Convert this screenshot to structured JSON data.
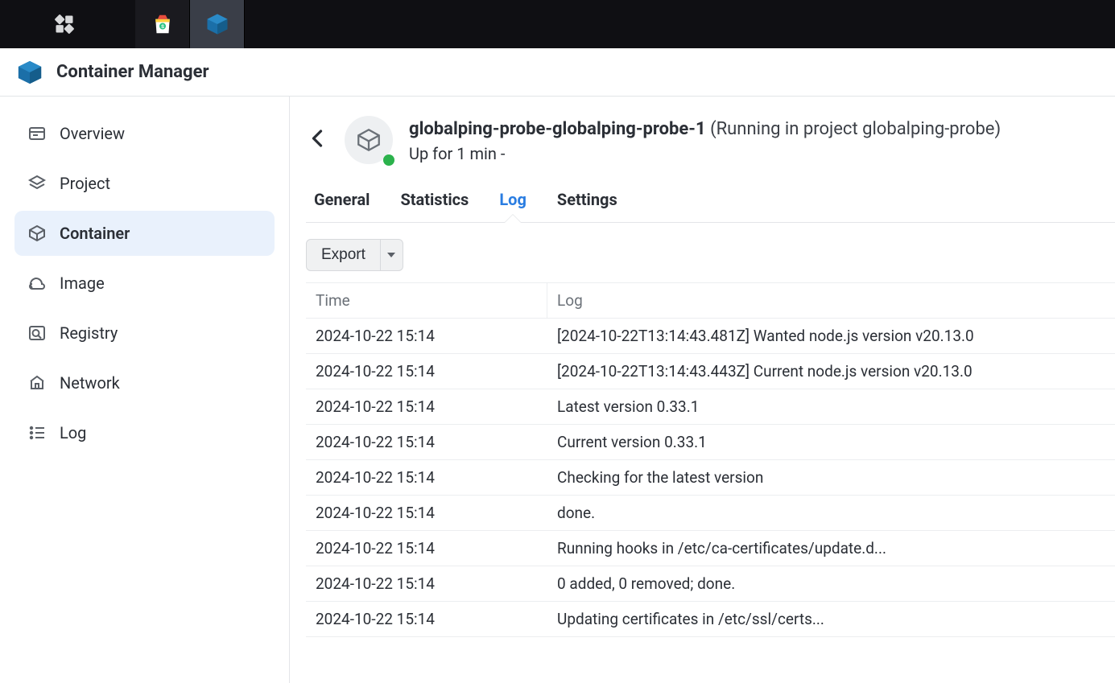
{
  "app": {
    "title": "Container Manager"
  },
  "sidebar": {
    "items": [
      {
        "label": "Overview",
        "icon": "overview",
        "selected": false
      },
      {
        "label": "Project",
        "icon": "project",
        "selected": false
      },
      {
        "label": "Container",
        "icon": "container",
        "selected": true
      },
      {
        "label": "Image",
        "icon": "image",
        "selected": false
      },
      {
        "label": "Registry",
        "icon": "registry",
        "selected": false
      },
      {
        "label": "Network",
        "icon": "network",
        "selected": false
      },
      {
        "label": "Log",
        "icon": "log",
        "selected": false
      }
    ]
  },
  "detail": {
    "name": "globalping-probe-globalping-probe-1",
    "info": "(Running in project globalping-probe)",
    "sub": "Up for 1 min -",
    "status": "running"
  },
  "tabs": [
    {
      "label": "General",
      "selected": false
    },
    {
      "label": "Statistics",
      "selected": false
    },
    {
      "label": "Log",
      "selected": true
    },
    {
      "label": "Settings",
      "selected": false
    }
  ],
  "toolbar": {
    "export_label": "Export"
  },
  "log": {
    "columns": {
      "time": "Time",
      "log": "Log"
    },
    "rows": [
      {
        "time": "2024-10-22 15:14",
        "msg": "[2024-10-22T13:14:43.481Z] Wanted node.js version v20.13.0"
      },
      {
        "time": "2024-10-22 15:14",
        "msg": "[2024-10-22T13:14:43.443Z] Current node.js version v20.13.0"
      },
      {
        "time": "2024-10-22 15:14",
        "msg": "Latest version 0.33.1"
      },
      {
        "time": "2024-10-22 15:14",
        "msg": "Current version 0.33.1"
      },
      {
        "time": "2024-10-22 15:14",
        "msg": "Checking for the latest version"
      },
      {
        "time": "2024-10-22 15:14",
        "msg": "done."
      },
      {
        "time": "2024-10-22 15:14",
        "msg": "Running hooks in /etc/ca-certificates/update.d..."
      },
      {
        "time": "2024-10-22 15:14",
        "msg": "0 added, 0 removed; done."
      },
      {
        "time": "2024-10-22 15:14",
        "msg": "Updating certificates in /etc/ssl/certs..."
      }
    ]
  }
}
